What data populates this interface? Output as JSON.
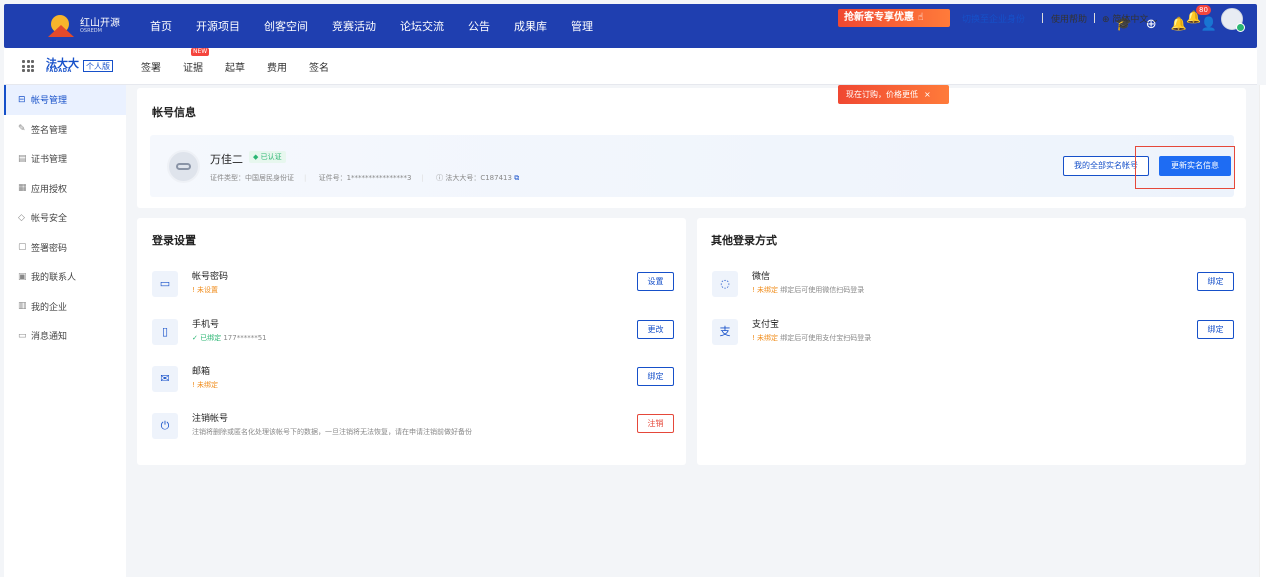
{
  "topnav": {
    "logo_cn": "红山开源",
    "logo_en": "OSREDM",
    "items": [
      "首页",
      "开源项目",
      "创客空间",
      "竞赛活动",
      "论坛交流",
      "公告",
      "成果库",
      "管理"
    ]
  },
  "subheader": {
    "brand_cn": "法大大",
    "brand_en": "FADADA",
    "personal_tag": "个人版",
    "nav": [
      "签署",
      "证据",
      "起草",
      "费用",
      "签名"
    ],
    "new_badge": "NEW",
    "promo": "抢新客专享优惠",
    "switch": "切换至企业身份",
    "help": "使用帮助",
    "lang": "简体中文",
    "notif_count": "80",
    "promo_tip": "现在订购，价格更低"
  },
  "sidebar": {
    "items": [
      "帐号管理",
      "签名管理",
      "证书管理",
      "应用授权",
      "帐号安全",
      "签署密码",
      "我的联系人",
      "我的企业",
      "消息通知"
    ]
  },
  "account": {
    "title": "帐号信息",
    "name": "万佳二",
    "verified": "已认证",
    "id_type": "证件类型：中国居民身份证",
    "id_no": "证件号：1****************3",
    "fdd_no": "法大大号：C187413",
    "all_accounts": "我的全部实名帐号",
    "update": "更新实名信息"
  },
  "login": {
    "title": "登录设置",
    "rows": [
      {
        "label": "帐号密码",
        "status": "未设置",
        "button": "设置"
      },
      {
        "label": "手机号",
        "status": "已绑定",
        "extra": "177******51",
        "button": "更改"
      },
      {
        "label": "邮箱",
        "status": "未绑定",
        "button": "绑定"
      },
      {
        "label": "注销帐号",
        "desc": "注销将删除或匿名化处理该帐号下的数据，一旦注销将无法恢复，请在申请注销前做好备份",
        "button": "注销"
      }
    ]
  },
  "other": {
    "title": "其他登录方式",
    "rows": [
      {
        "label": "微信",
        "status": "未绑定",
        "desc": "绑定后可使用微信扫码登录",
        "button": "绑定"
      },
      {
        "label": "支付宝",
        "status": "未绑定",
        "desc": "绑定后可使用支付宝扫码登录",
        "button": "绑定"
      }
    ]
  }
}
